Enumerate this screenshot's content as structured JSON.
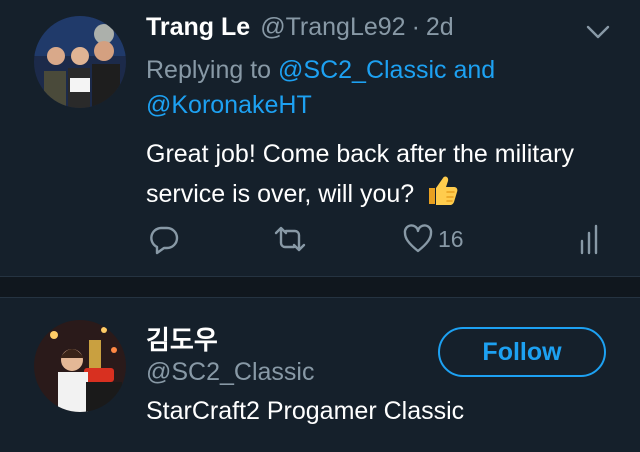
{
  "tweet": {
    "display_name": "Trang Le",
    "handle": "@TrangLe92",
    "separator": "·",
    "age": "2d",
    "reply_prefix": "Replying to",
    "mention_1": "@SC2_Classic and",
    "mention_2": "@KoronakeHT",
    "text": "Great job! Come back after the military service is over, will you?",
    "like_count": "16"
  },
  "user_card": {
    "name": "김도우",
    "handle": "@SC2_Classic",
    "bio": "StarCraft2 Progamer Classic",
    "follow_label": "Follow"
  },
  "colors": {
    "background": "#15202b",
    "secondary_text": "#8899a6",
    "accent": "#1da1f2",
    "divider": "#10171e"
  },
  "icons": [
    "chevron-down-icon",
    "reply-icon",
    "retweet-icon",
    "heart-icon",
    "stats-icon",
    "thumbs-up-emoji"
  ]
}
